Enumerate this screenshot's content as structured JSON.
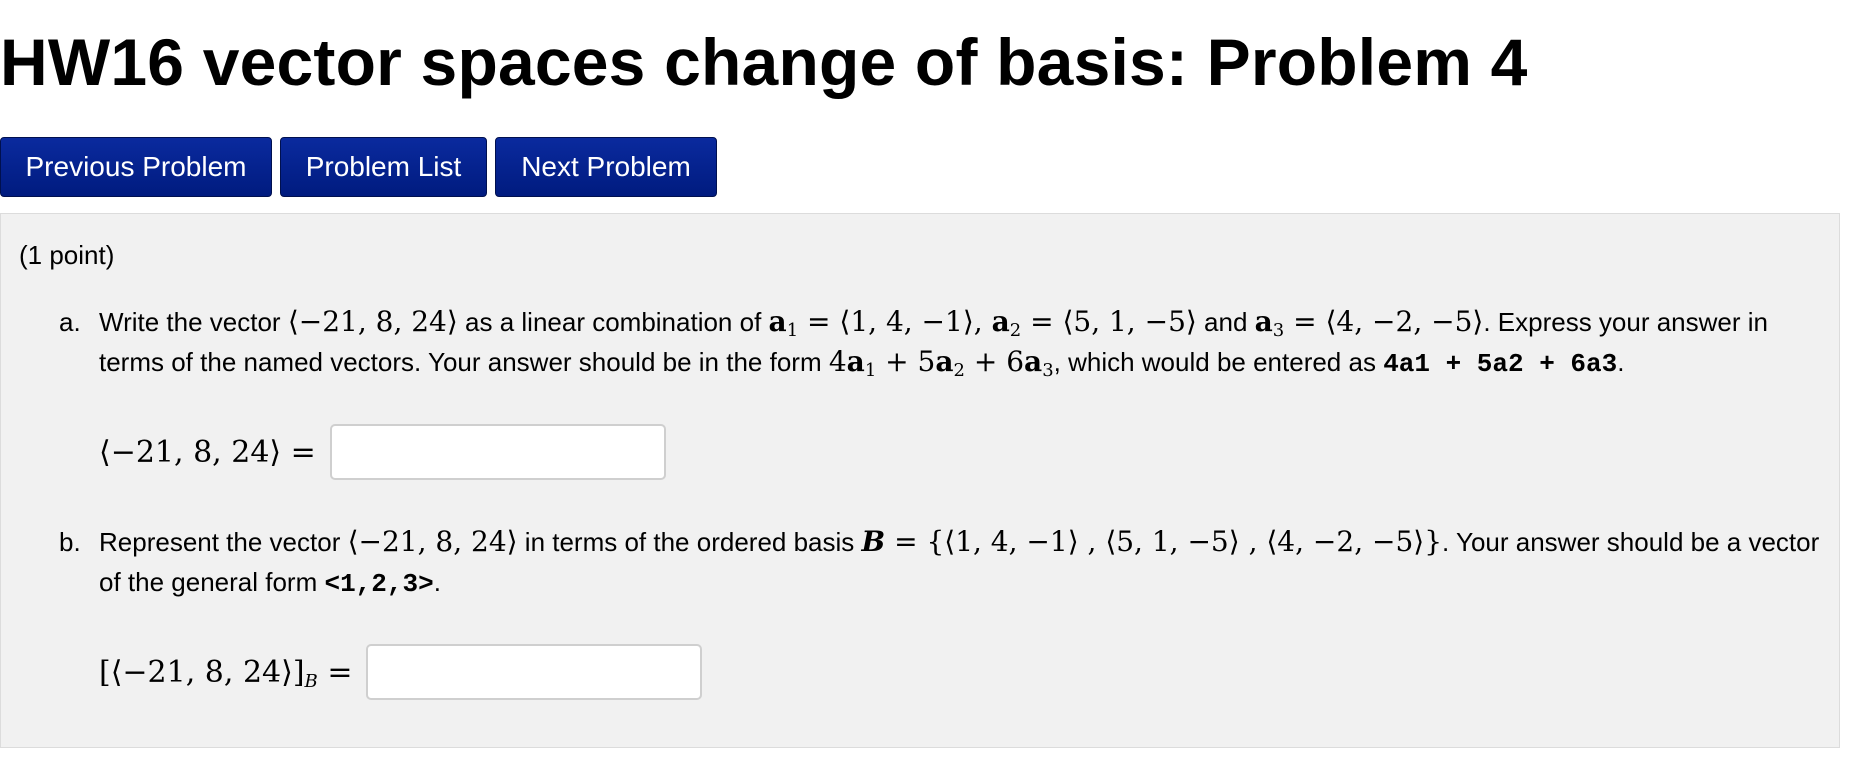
{
  "page": {
    "title": "HW16 vector spaces change of basis: Problem 4"
  },
  "nav": {
    "previous_label": "Previous Problem",
    "list_label": "Problem List",
    "next_label": "Next Problem"
  },
  "problem": {
    "points": "(1 point)",
    "part_a": {
      "marker": "a.",
      "t1": "Write the vector ",
      "v": "⟨−21, 8, 24⟩",
      "t2": " as a linear combination of ",
      "a1": "a",
      "a1_sub": "1",
      "a1_val": " = ⟨1, 4, −1⟩",
      "sep1": ", ",
      "a2": "a",
      "a2_sub": "2",
      "a2_val": " = ⟨5, 1, −5⟩",
      "t3": " and ",
      "a3": "a",
      "a3_sub": "3",
      "a3_val": " = ⟨4, −2, −5⟩",
      "t4": ". Express your answer in terms of the named vectors. Your answer should be in the form ",
      "f1": "4",
      "fa1": "a",
      "fa1_sub": "1",
      "f2": " + 5",
      "fa2": "a",
      "fa2_sub": "2",
      "f3": " + 6",
      "fa3": "a",
      "fa3_sub": "3",
      "t5": ", which would be entered as ",
      "code": "4a1 + 5a2 + 6a3",
      "t6": ".",
      "answer_label": "⟨−21, 8, 24⟩ =",
      "answer_value": ""
    },
    "part_b": {
      "marker": "b.",
      "t1": "Represent the vector ",
      "v": "⟨−21, 8, 24⟩",
      "t2": " in terms of the ordered basis ",
      "basis_symbol": "B",
      "basis_val": " = {⟨1, 4, −1⟩ , ⟨5, 1, −5⟩ , ⟨4, −2, −5⟩}",
      "t3": ". Your answer should be a vector of the general form ",
      "code": "<1,2,3>",
      "t4": ".",
      "answer_label": "[⟨−21, 8, 24⟩]",
      "answer_label_sub": "B",
      "answer_label_eq": " =",
      "answer_value": ""
    }
  },
  "colors": {
    "button_bg": "#001e8c",
    "panel_bg": "#f1f1f1"
  }
}
